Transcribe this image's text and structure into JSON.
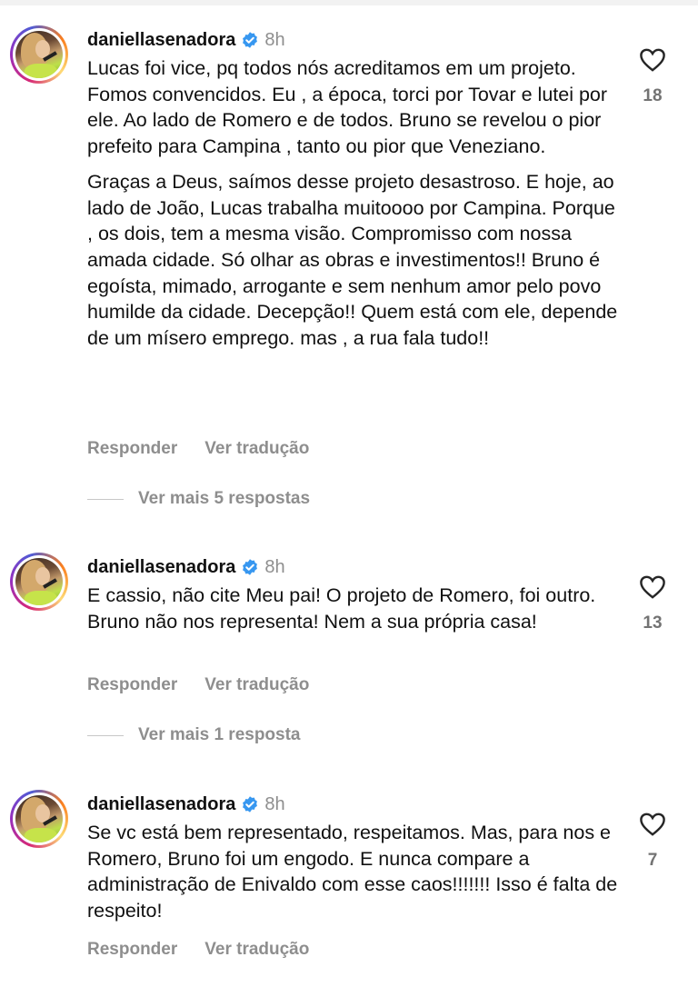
{
  "comments": [
    {
      "username": "daniellasenadora",
      "time": "8h",
      "paragraphs": [
        "Lucas foi vice, pq todos nós acreditamos em um projeto. Fomos convencidos. Eu , a época, torci por Tovar e lutei por ele. Ao lado de Romero e de todos. Bruno se revelou o pior prefeito para Campina , tanto ou pior que Veneziano.",
        "Graças a Deus, saímos desse projeto desastroso. E hoje, ao lado de João, Lucas trabalha muitoooo por Campina. Porque , os dois, tem a mesma visão. Compromisso com nossa amada cidade. Só olhar as obras e investimentos!! Bruno é egoísta, mimado, arrogante e sem nenhum amor pelo povo humilde da cidade. Decepção!! Quem está com ele, depende de um mísero emprego. mas , a rua fala tudo!!"
      ],
      "likes": "18",
      "reply_label": "Responder",
      "translate_label": "Ver tradução",
      "more_replies": "Ver mais 5 respostas"
    },
    {
      "username": "daniellasenadora",
      "time": "8h",
      "paragraphs": [
        "E cassio, não cite Meu pai! O projeto de Romero, foi outro. Bruno não nos representa! Nem a sua própria casa!"
      ],
      "likes": "13",
      "reply_label": "Responder",
      "translate_label": "Ver tradução",
      "more_replies": "Ver mais 1 resposta"
    },
    {
      "username": "daniellasenadora",
      "time": "8h",
      "paragraphs": [
        "Se vc está bem representado, respeitamos. Mas, para nos e Romero, Bruno foi um engodo. E nunca compare a administração de Enivaldo com esse caos!!!!!!! Isso é falta de respeito!"
      ],
      "likes": "7",
      "reply_label": "Responder",
      "translate_label": "Ver tradução"
    }
  ],
  "colors": {
    "verified_badge": "#3797f0",
    "secondary_text": "#8e8e8e",
    "primary_text": "#111111"
  },
  "icons": [
    "verified-badge-icon",
    "heart-icon",
    "avatar"
  ]
}
